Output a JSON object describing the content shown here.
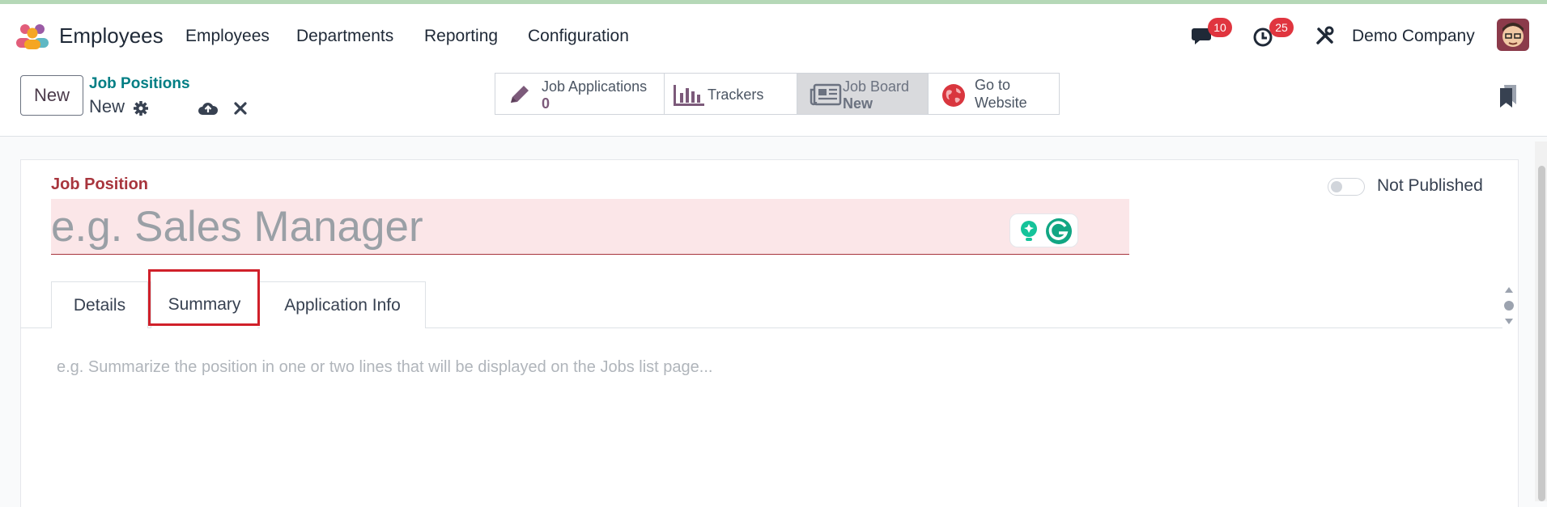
{
  "nav": {
    "app_name": "Employees",
    "menu": [
      "Employees",
      "Departments",
      "Reporting",
      "Configuration"
    ],
    "messages_count": "10",
    "activities_count": "25",
    "company": "Demo Company"
  },
  "control_panel": {
    "new_label": "New",
    "breadcrumb_parent": "Job Positions",
    "breadcrumb_current": "New",
    "smart_buttons": {
      "applications_label": "Job Applications",
      "applications_value": "0",
      "trackers_label": "Trackers",
      "job_board_label": "Job Board",
      "job_board_value": "New",
      "website_label_1": "Go to",
      "website_label_2": "Website"
    }
  },
  "form": {
    "field_label": "Job Position",
    "name_placeholder": "e.g. Sales Manager",
    "published_label": "Not Published",
    "tabs": [
      "Details",
      "Summary",
      "Application Info"
    ],
    "summary_placeholder": "e.g. Summarize the position in one or two lines that will be displayed on the Jobs list page..."
  },
  "colors": {
    "brand_link": "#017e84",
    "required_label": "#a8353d",
    "badge": "#e0353f",
    "highlight": "#d0202a"
  }
}
